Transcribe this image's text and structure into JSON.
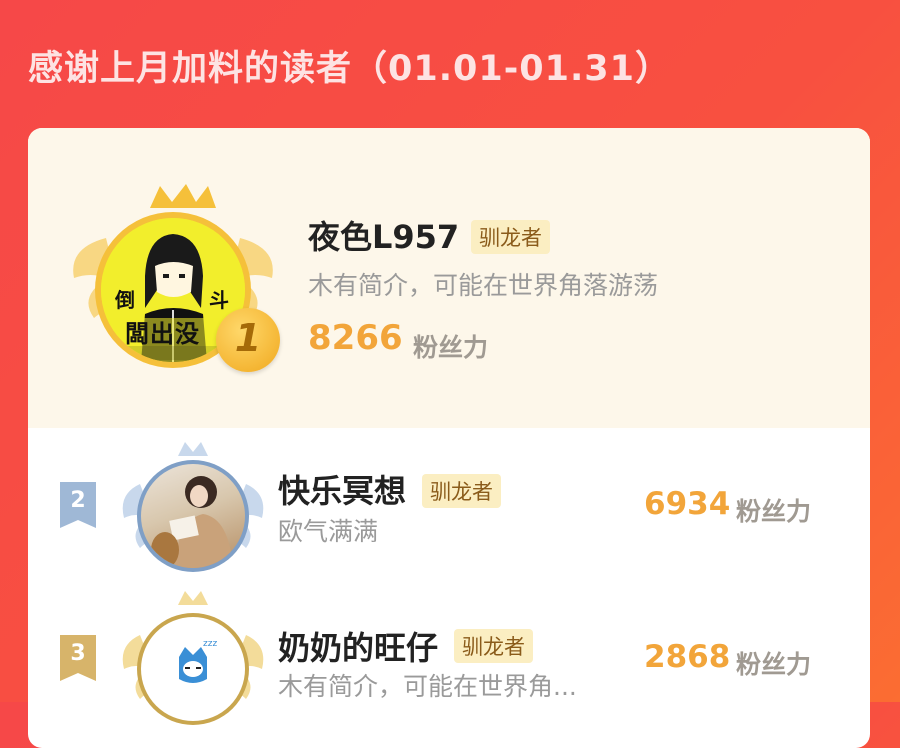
{
  "page": {
    "title": "感谢上月加料的读者（01.01-01.31）"
  },
  "readers": [
    {
      "rank": "1",
      "name": "夜色L957",
      "badge": "驯龙者",
      "bio": "木有简介，可能在世界角落游荡",
      "score": "8266",
      "score_unit": "粉丝力",
      "avatar_text_left": "倒",
      "avatar_text_right": "斗",
      "avatar_text_bottom": "闆出没"
    },
    {
      "rank": "2",
      "name": "快乐冥想",
      "badge": "驯龙者",
      "bio": "欧气满满",
      "score": "6934",
      "score_unit": "粉丝力"
    },
    {
      "rank": "3",
      "name": "奶奶的旺仔",
      "badge": "驯龙者",
      "bio": "木有简介，可能在世界角...",
      "score": "2868",
      "score_unit": "粉丝力",
      "avatar_text_zzz": "zzz"
    }
  ],
  "colors": {
    "header_gradient_start": "#f64848",
    "header_gradient_end": "#fb6d32",
    "top_card_bg": "#fdf7ea",
    "score": "#f2a53a",
    "badge_bg": "#fbeec2",
    "gold": "#f5c03a",
    "silver": "#9fb8d6",
    "bronze": "#d7b46a"
  }
}
